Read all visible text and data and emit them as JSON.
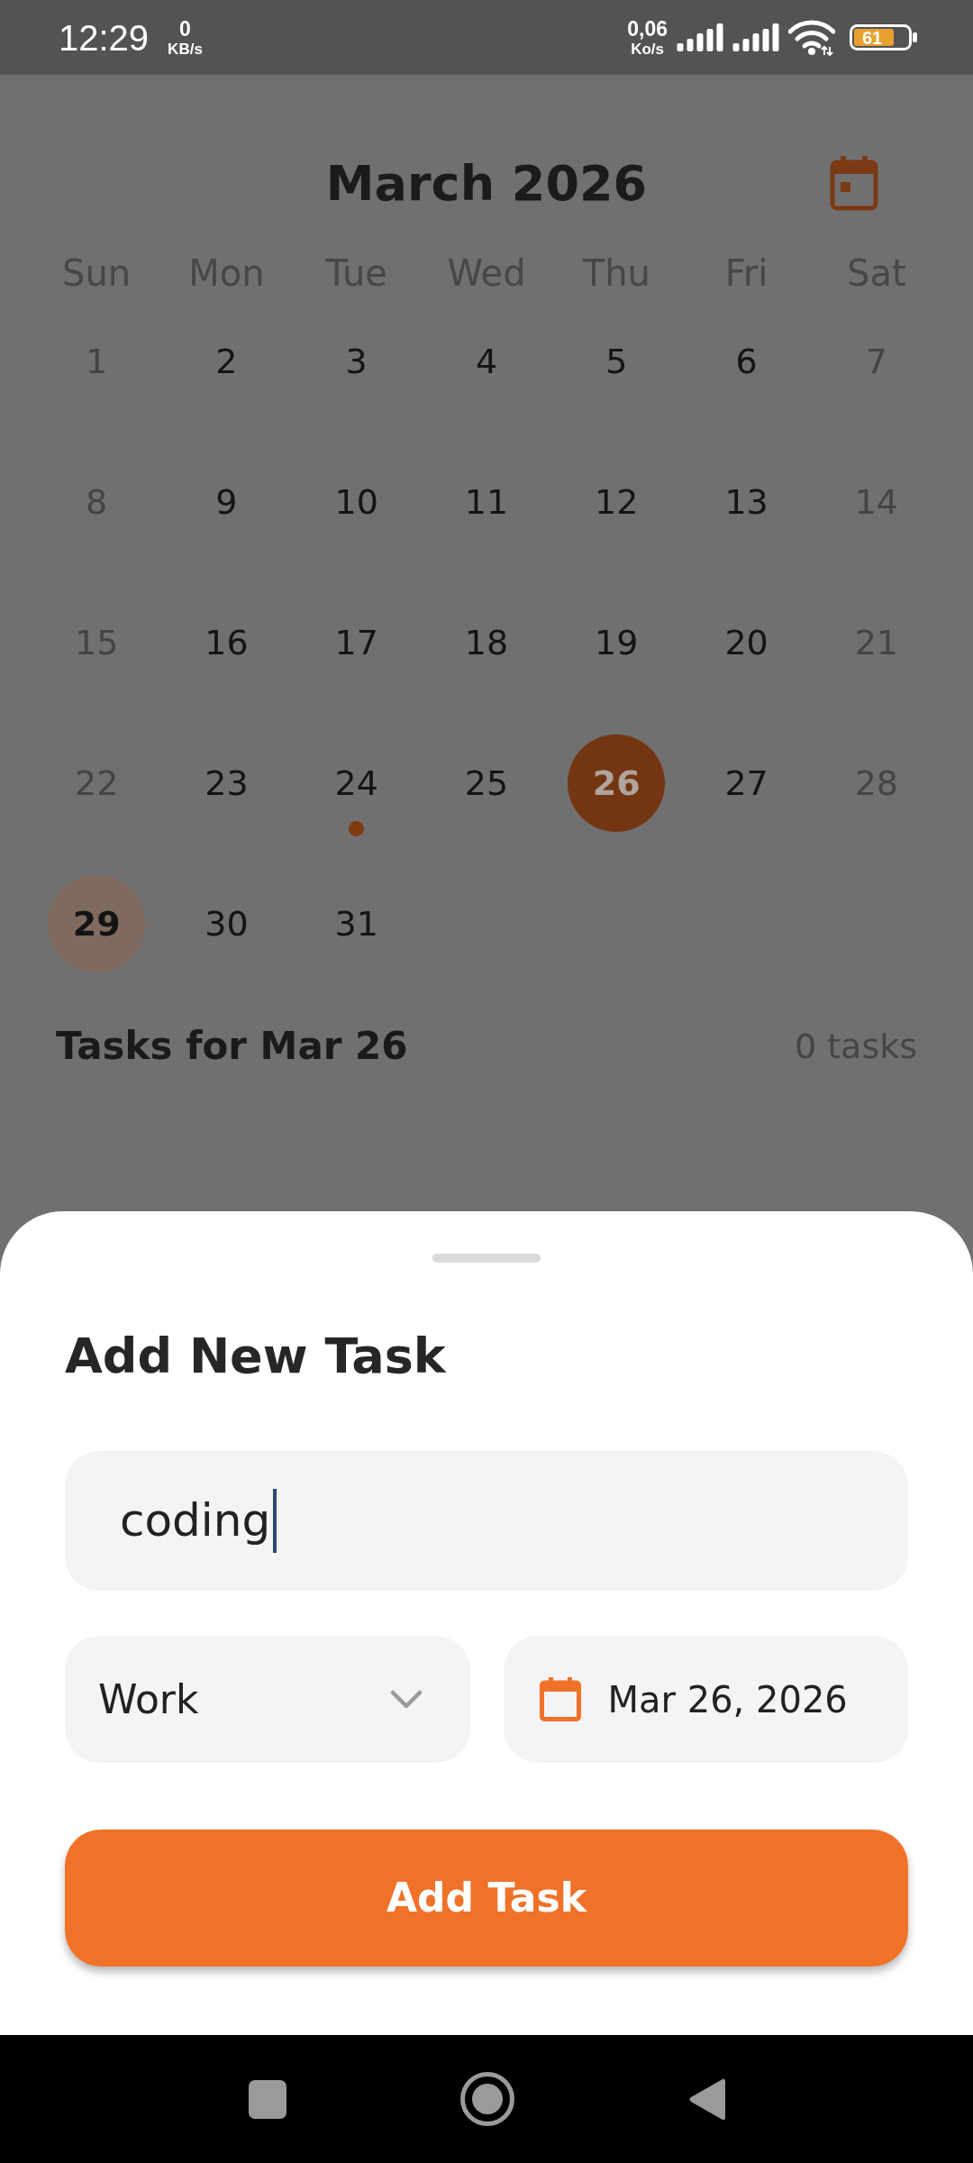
{
  "status_bar": {
    "time": "12:29",
    "speed_left": {
      "value": "0",
      "unit": "KB/s"
    },
    "speed_right": {
      "value": "0,06",
      "unit": "Ko/s"
    },
    "battery": "61"
  },
  "calendar": {
    "title": "March 2026",
    "weekdays": [
      "Sun",
      "Mon",
      "Tue",
      "Wed",
      "Thu",
      "Fri",
      "Sat"
    ],
    "days": [
      {
        "label": "1",
        "dimmed": true,
        "selected": false,
        "today": false,
        "has_tasks": false
      },
      {
        "label": "2",
        "dimmed": false,
        "selected": false,
        "today": false,
        "has_tasks": false
      },
      {
        "label": "3",
        "dimmed": false,
        "selected": false,
        "today": false,
        "has_tasks": false
      },
      {
        "label": "4",
        "dimmed": false,
        "selected": false,
        "today": false,
        "has_tasks": false
      },
      {
        "label": "5",
        "dimmed": false,
        "selected": false,
        "today": false,
        "has_tasks": false
      },
      {
        "label": "6",
        "dimmed": false,
        "selected": false,
        "today": false,
        "has_tasks": false
      },
      {
        "label": "7",
        "dimmed": true,
        "selected": false,
        "today": false,
        "has_tasks": false
      },
      {
        "label": "8",
        "dimmed": true,
        "selected": false,
        "today": false,
        "has_tasks": false
      },
      {
        "label": "9",
        "dimmed": false,
        "selected": false,
        "today": false,
        "has_tasks": false
      },
      {
        "label": "10",
        "dimmed": false,
        "selected": false,
        "today": false,
        "has_tasks": false
      },
      {
        "label": "11",
        "dimmed": false,
        "selected": false,
        "today": false,
        "has_tasks": false
      },
      {
        "label": "12",
        "dimmed": false,
        "selected": false,
        "today": false,
        "has_tasks": false
      },
      {
        "label": "13",
        "dimmed": false,
        "selected": false,
        "today": false,
        "has_tasks": false
      },
      {
        "label": "14",
        "dimmed": true,
        "selected": false,
        "today": false,
        "has_tasks": false
      },
      {
        "label": "15",
        "dimmed": true,
        "selected": false,
        "today": false,
        "has_tasks": false
      },
      {
        "label": "16",
        "dimmed": false,
        "selected": false,
        "today": false,
        "has_tasks": false
      },
      {
        "label": "17",
        "dimmed": false,
        "selected": false,
        "today": false,
        "has_tasks": false
      },
      {
        "label": "18",
        "dimmed": false,
        "selected": false,
        "today": false,
        "has_tasks": false
      },
      {
        "label": "19",
        "dimmed": false,
        "selected": false,
        "today": false,
        "has_tasks": false
      },
      {
        "label": "20",
        "dimmed": false,
        "selected": false,
        "today": false,
        "has_tasks": false
      },
      {
        "label": "21",
        "dimmed": true,
        "selected": false,
        "today": false,
        "has_tasks": false
      },
      {
        "label": "22",
        "dimmed": true,
        "selected": false,
        "today": false,
        "has_tasks": false
      },
      {
        "label": "23",
        "dimmed": false,
        "selected": false,
        "today": false,
        "has_tasks": false
      },
      {
        "label": "24",
        "dimmed": false,
        "selected": false,
        "today": false,
        "has_tasks": true
      },
      {
        "label": "25",
        "dimmed": false,
        "selected": false,
        "today": false,
        "has_tasks": false
      },
      {
        "label": "26",
        "dimmed": false,
        "selected": true,
        "today": false,
        "has_tasks": false
      },
      {
        "label": "27",
        "dimmed": false,
        "selected": false,
        "today": false,
        "has_tasks": false
      },
      {
        "label": "28",
        "dimmed": true,
        "selected": false,
        "today": false,
        "has_tasks": false
      },
      {
        "label": "29",
        "dimmed": false,
        "selected": false,
        "today": true,
        "has_tasks": false
      },
      {
        "label": "30",
        "dimmed": false,
        "selected": false,
        "today": false,
        "has_tasks": false
      },
      {
        "label": "31",
        "dimmed": false,
        "selected": false,
        "today": false,
        "has_tasks": false
      }
    ]
  },
  "tasks_header": {
    "title": "Tasks for Mar 26",
    "count": "0 tasks"
  },
  "add_task_sheet": {
    "title": "Add New Task",
    "task_field": {
      "value": "coding",
      "focused": true
    },
    "category_field": {
      "value": "Work"
    },
    "date_field": {
      "value": "Mar 26, 2026"
    },
    "submit_button": "Add Task"
  }
}
